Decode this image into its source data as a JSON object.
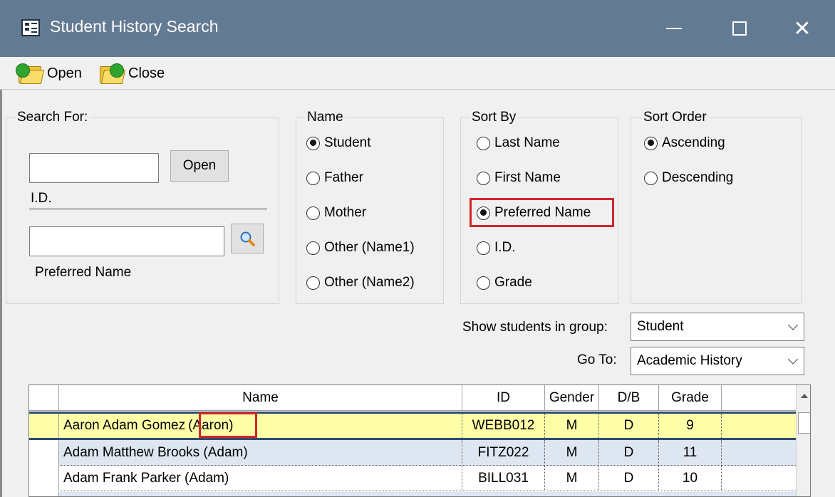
{
  "window": {
    "title": "Student History Search",
    "minimize": "—",
    "close": "✕"
  },
  "toolbar": {
    "open_label": "Open",
    "close_label": "Close"
  },
  "search_for": {
    "legend": "Search For:",
    "id_value": "",
    "open_button": "Open",
    "id_label": "I.D.",
    "preferred_value": "",
    "preferred_label": "Preferred Name"
  },
  "name_group": {
    "legend": "Name",
    "options": [
      "Student",
      "Father",
      "Mother",
      "Other (Name1)",
      "Other (Name2)"
    ],
    "selected": "Student"
  },
  "sort_by": {
    "legend": "Sort By",
    "options": [
      "Last Name",
      "First Name",
      "Preferred Name",
      "I.D.",
      "Grade"
    ],
    "selected": "Preferred Name"
  },
  "sort_order": {
    "legend": "Sort Order",
    "options": [
      "Ascending",
      "Descending"
    ],
    "selected": "Ascending"
  },
  "group_filter": {
    "label": "Show students in group:",
    "value": "Student"
  },
  "goto": {
    "label": "Go To:",
    "value": "Academic History"
  },
  "grid": {
    "columns": [
      "Name",
      "ID",
      "Gender",
      "D/B",
      "Grade"
    ],
    "rows": [
      {
        "name": "Aaron Adam Gomez",
        "preferred": "(Aaron)",
        "id": "WEBB012",
        "gender": "M",
        "db": "D",
        "grade": "9"
      },
      {
        "name": "Adam Matthew Brooks (Adam)",
        "id": "FITZ022",
        "gender": "M",
        "db": "D",
        "grade": "11"
      },
      {
        "name": "Adam Frank Parker (Adam)",
        "id": "BILL031",
        "gender": "M",
        "db": "D",
        "grade": "10"
      }
    ]
  },
  "colors": {
    "titlebar": "#637a93",
    "selected_row": "#ffffa8",
    "alt_row": "#dde6f1",
    "highlight": "#d0262c"
  }
}
